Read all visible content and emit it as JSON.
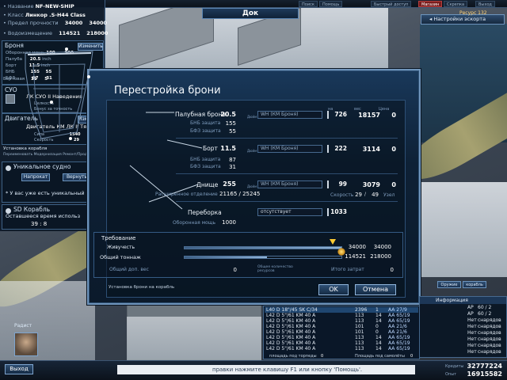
{
  "top": {
    "dock_title": "Док",
    "buttons": [
      "Поиск",
      "Помощь",
      "Быстрый доступ",
      "Магазин",
      "Скрепка",
      "Выход"
    ],
    "settings_label": "Настройки эскорта",
    "settings_extra": "Ресурс 132"
  },
  "left": {
    "name_label": "• Название",
    "name_value": "NF-NEW-SHIP",
    "class_label": "• Класс",
    "class_value": "Линкор .S-H44 Class",
    "limit_label": "• Предел прочности",
    "limit_a": "34000",
    "limit_b": "34000",
    "disp_label": "• Водоизмещение",
    "disp_a": "114521",
    "disp_b": "218000",
    "armor_head": "Броня",
    "armor_btn": "Изменить",
    "armor_rows": [
      {
        "label": "Оборонная мощь",
        "a": "100",
        "b": "900"
      },
      {
        "label": "Палуба",
        "a": "20.5",
        "b": "inch"
      },
      {
        "label": "Борт",
        "a": "11.5",
        "b": "inch"
      },
      {
        "label": "БНБ",
        "a": "155",
        "b": "55"
      },
      {
        "label": "БФЗ",
        "a": "87",
        "b": "31"
      },
      {
        "label": "Бортовая",
        "a": "11",
        "b": "5"
      }
    ],
    "cuo_head": "СУО",
    "cuo_name": "ЛК СУО II Наведения",
    "cuo_sub1": "Целкость",
    "cuo_sub2": "Бонус за точность",
    "engine_head": "Двигатель",
    "engine_btn": "Изменить",
    "engine_name": "Двигатель КМ ЛК II Тях",
    "engine_power": "Сила",
    "engine_power_val": "1540",
    "engine_speed": "Скорость",
    "engine_speed_val": "29",
    "install_label": "Установка корабля",
    "install_sub": "Переименовать  Модернизация  Ремонт/Продажа",
    "unique_head": "Уникальное судно",
    "unique_btn1": "Напрокат",
    "unique_btn2": "Вернуть",
    "unique_note": "* У вас уже есть уникальный",
    "sd_head": "SD Корабль",
    "sd_time_label": "Оставшееся время использ",
    "sd_time": "39 : 8"
  },
  "dialog": {
    "title": "Перестройка брони",
    "col_headers": [
      "на",
      "вес",
      "Цена"
    ],
    "rows": [
      {
        "name": "Палубная броня",
        "value": "20.5",
        "unit": "Дюйм",
        "field": "WH (КМ Броня)",
        "na": "726",
        "ves": "18157",
        "cena": "0",
        "subs": [
          {
            "label": "БНБ защита",
            "value": "155"
          },
          {
            "label": "БФЗ защита",
            "value": "55"
          }
        ]
      },
      {
        "name": "Борт",
        "value": "11.5",
        "unit": "Дюйм",
        "field": "WH (КМ Броня)",
        "na": "222",
        "ves": "3114",
        "cena": "0",
        "subs": [
          {
            "label": "БНБ защита",
            "value": "87"
          },
          {
            "label": "БФЗ защита",
            "value": "31"
          }
        ]
      },
      {
        "name": "Днище",
        "value": "255",
        "unit": "Дюйм",
        "field": "WH (КМ Броня)",
        "na": "99",
        "ves": "3079",
        "cena": "0",
        "subs": [
          {
            "label": "Расширенное отделение",
            "value": "21165 / 25245"
          }
        ]
      },
      {
        "name": "Переборка",
        "value": "0",
        "unit": "Дюйм",
        "field": "отсутствует",
        "na": "1033",
        "ves": "",
        "cena": "",
        "subs": [
          {
            "label": "Оборонная мощь",
            "value": "1000"
          }
        ]
      }
    ],
    "speed_label": "Скорость",
    "speed_a": "29",
    "speed_b": "49",
    "speed_unit": "Узел",
    "req_head": "Требование",
    "live_label": "Живучесть",
    "live_a": "34000",
    "live_b": "34000",
    "live_ratio": 1.0,
    "tonnage_label": "Общий тоннаж",
    "tonnage_a": "114521",
    "tonnage_b": "218000",
    "tonnage_ratio": 0.525,
    "total_def_label": "Общий доп. вес",
    "total_def_val": "0",
    "total_res_label": "Общее количество ресурсов",
    "total_cost_label": "Итого затрат",
    "total_cost_val": "0",
    "footer_note": "Установка брони на корабль",
    "ok_label": "OK",
    "cancel_label": "Отмена"
  },
  "right": {
    "tab1": "Оружие",
    "tab2": "корабль",
    "info_head": "Информация",
    "info_rows": [
      {
        "a": "AP",
        "b": "60 / 2"
      },
      {
        "a": "AP",
        "b": "60 / 2"
      },
      {
        "a": "Нет",
        "b": "снарядов"
      },
      {
        "a": "Нет",
        "b": "снарядов"
      },
      {
        "a": "Нет",
        "b": "снарядов"
      },
      {
        "a": "Нет",
        "b": "снарядов"
      },
      {
        "a": "Нет",
        "b": "снарядов"
      },
      {
        "a": "Нет",
        "b": "снарядов"
      }
    ],
    "weapons": [
      {
        "name": "L40 D 18\"/45 SK C/34",
        "n1": "2396",
        "n2": "1",
        "ammo": "AA  27/9"
      },
      {
        "name": "L42 D 5\"/61 KM 40 A",
        "n1": "113",
        "n2": "14",
        "ammo": "AA  65/19"
      },
      {
        "name": "L42 D 5\"/61 KM 40 A",
        "n1": "113",
        "n2": "14",
        "ammo": "AA  65/19"
      },
      {
        "name": "L42 D 5\"/61 KM 40 A",
        "n1": "101",
        "n2": "0",
        "ammo": "AA  21/6"
      },
      {
        "name": "L42 D 5\"/61 KM 40 A",
        "n1": "101",
        "n2": "0",
        "ammo": "AA  21/6"
      },
      {
        "name": "L42 D 5\"/61 KM 40 A",
        "n1": "113",
        "n2": "14",
        "ammo": "AA  65/19"
      },
      {
        "name": "L42 D 5\"/61 KM 40 A",
        "n1": "113",
        "n2": "14",
        "ammo": "AA  65/19"
      },
      {
        "name": "L42 D 5\"/61 KM 40 A",
        "n1": "113",
        "n2": "14",
        "ammo": "AA  65/19"
      }
    ],
    "list_footer1": "площадь под торпеды",
    "list_footer1_val": "0",
    "list_footer2": "Площадь под самолёты",
    "list_footer2_val": "0"
  },
  "bottom": {
    "exit_label": "Выход",
    "radist": "Радист",
    "ticker": "правки нажмите клавишу F1 или кнопку 'Помощь'.",
    "credits_label": "Кредиты",
    "credits": "32777224",
    "opyt_label": "Опыт",
    "opyt": "16915582"
  },
  "colors": {
    "accent": "#6f94bb",
    "panel": "#0e2136",
    "text": "#dfe8f3"
  }
}
